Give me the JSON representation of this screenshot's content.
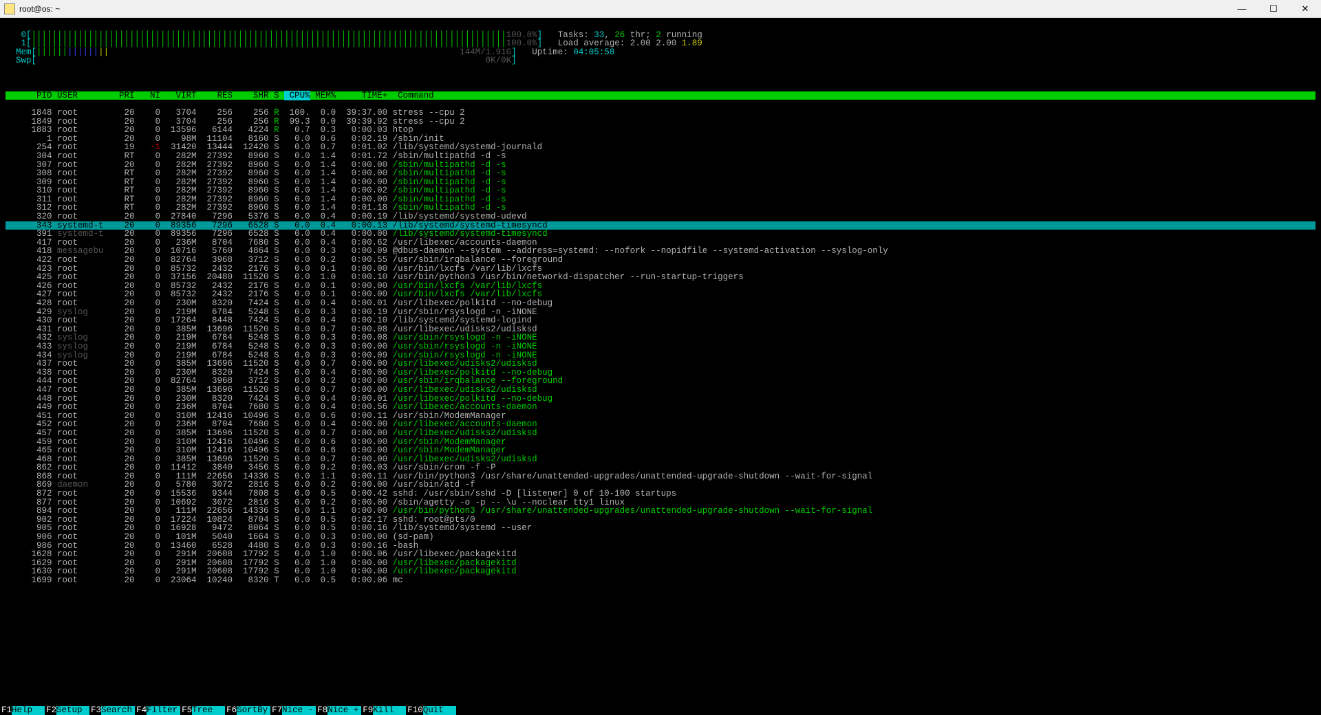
{
  "window": {
    "title": "root@os: ~"
  },
  "cpus": [
    {
      "id": "0",
      "percent": "100.0%"
    },
    {
      "id": "1",
      "percent": "100.0%"
    }
  ],
  "mem": {
    "label": "Mem",
    "used": "144M",
    "total": "1.91G"
  },
  "swp": {
    "label": "Swp",
    "used": "0K",
    "total": "0K"
  },
  "summary": {
    "tasks": "Tasks: 33, 26 thr; 2 running",
    "load": "Load average: 2.00 2.00 1.89",
    "uptime": "Uptime: 04:05:58"
  },
  "cols": [
    "PID",
    "USER",
    "PRI",
    "NI",
    "VIRT",
    "RES",
    "SHR",
    "S",
    "CPU%",
    "MEM%",
    "TIME+",
    "Command"
  ],
  "selected_pid": 343,
  "processes": [
    {
      "pid": 1848,
      "user": "root",
      "pri": "20",
      "ni": "0",
      "virt": "3704",
      "res": "256",
      "shr": "256",
      "s": "R",
      "cpu": "100.",
      "mem": "0.0",
      "time": "39:37.00",
      "cmd": "stress --cpu 2",
      "style": "plain"
    },
    {
      "pid": 1849,
      "user": "root",
      "pri": "20",
      "ni": "0",
      "virt": "3704",
      "res": "256",
      "shr": "256",
      "s": "R",
      "cpu": "99.3",
      "mem": "0.0",
      "time": "39:39.92",
      "cmd": "stress --cpu 2",
      "style": "plain"
    },
    {
      "pid": 1883,
      "user": "root",
      "pri": "20",
      "ni": "0",
      "virt": "13596",
      "res": "6144",
      "shr": "4224",
      "s": "R",
      "cpu": "0.7",
      "mem": "0.3",
      "time": "0:00.03",
      "cmd": "htop",
      "style": "plain"
    },
    {
      "pid": 1,
      "user": "root",
      "pri": "20",
      "ni": "0",
      "virt": "98M",
      "res": "11104",
      "shr": "8160",
      "s": "S",
      "cpu": "0.0",
      "mem": "0.6",
      "time": "0:02.19",
      "cmd": "/sbin/init",
      "style": "plain"
    },
    {
      "pid": 254,
      "user": "root",
      "pri": "19",
      "ni": "-1",
      "virt": "31420",
      "res": "13444",
      "shr": "12420",
      "s": "S",
      "cpu": "0.0",
      "mem": "0.7",
      "time": "0:01.02",
      "cmd": "/lib/systemd/systemd-journald",
      "style": "plain",
      "ni_red": true
    },
    {
      "pid": 304,
      "user": "root",
      "pri": "RT",
      "ni": "0",
      "virt": "282M",
      "res": "27392",
      "shr": "8960",
      "s": "S",
      "cpu": "0.0",
      "mem": "1.4",
      "time": "0:01.72",
      "cmd": "/sbin/multipathd -d -s",
      "style": "plain"
    },
    {
      "pid": 307,
      "user": "root",
      "pri": "20",
      "ni": "0",
      "virt": "282M",
      "res": "27392",
      "shr": "8960",
      "s": "S",
      "cpu": "0.0",
      "mem": "1.4",
      "time": "0:00.00",
      "cmd": "/sbin/multipathd -d -s",
      "style": "green"
    },
    {
      "pid": 308,
      "user": "root",
      "pri": "RT",
      "ni": "0",
      "virt": "282M",
      "res": "27392",
      "shr": "8960",
      "s": "S",
      "cpu": "0.0",
      "mem": "1.4",
      "time": "0:00.00",
      "cmd": "/sbin/multipathd -d -s",
      "style": "green"
    },
    {
      "pid": 309,
      "user": "root",
      "pri": "RT",
      "ni": "0",
      "virt": "282M",
      "res": "27392",
      "shr": "8960",
      "s": "S",
      "cpu": "0.0",
      "mem": "1.4",
      "time": "0:00.00",
      "cmd": "/sbin/multipathd -d -s",
      "style": "green"
    },
    {
      "pid": 310,
      "user": "root",
      "pri": "RT",
      "ni": "0",
      "virt": "282M",
      "res": "27392",
      "shr": "8960",
      "s": "S",
      "cpu": "0.0",
      "mem": "1.4",
      "time": "0:00.02",
      "cmd": "/sbin/multipathd -d -s",
      "style": "green"
    },
    {
      "pid": 311,
      "user": "root",
      "pri": "RT",
      "ni": "0",
      "virt": "282M",
      "res": "27392",
      "shr": "8960",
      "s": "S",
      "cpu": "0.0",
      "mem": "1.4",
      "time": "0:00.00",
      "cmd": "/sbin/multipathd -d -s",
      "style": "green"
    },
    {
      "pid": 312,
      "user": "root",
      "pri": "RT",
      "ni": "0",
      "virt": "282M",
      "res": "27392",
      "shr": "8960",
      "s": "S",
      "cpu": "0.0",
      "mem": "1.4",
      "time": "0:01.18",
      "cmd": "/sbin/multipathd -d -s",
      "style": "green"
    },
    {
      "pid": 320,
      "user": "root",
      "pri": "20",
      "ni": "0",
      "virt": "27840",
      "res": "7296",
      "shr": "5376",
      "s": "S",
      "cpu": "0.0",
      "mem": "0.4",
      "time": "0:00.19",
      "cmd": "/lib/systemd/systemd-udevd",
      "style": "plain"
    },
    {
      "pid": 343,
      "user": "systemd-t",
      "pri": "20",
      "ni": "0",
      "virt": "89356",
      "res": "7296",
      "shr": "6528",
      "s": "S",
      "cpu": "0.0",
      "mem": "0.4",
      "time": "0:00.13",
      "cmd": "/lib/systemd/systemd-timesyncd",
      "style": "selected"
    },
    {
      "pid": 391,
      "user": "systemd-t",
      "pri": "20",
      "ni": "0",
      "virt": "89356",
      "res": "7296",
      "shr": "6528",
      "s": "S",
      "cpu": "0.0",
      "mem": "0.4",
      "time": "0:00.00",
      "cmd": "/lib/systemd/systemd-timesyncd",
      "style": "green",
      "user_grey": true
    },
    {
      "pid": 417,
      "user": "root",
      "pri": "20",
      "ni": "0",
      "virt": "236M",
      "res": "8704",
      "shr": "7680",
      "s": "S",
      "cpu": "0.0",
      "mem": "0.4",
      "time": "0:00.62",
      "cmd": "/usr/libexec/accounts-daemon",
      "style": "plain"
    },
    {
      "pid": 418,
      "user": "messagebu",
      "pri": "20",
      "ni": "0",
      "virt": "10716",
      "res": "5760",
      "shr": "4864",
      "s": "S",
      "cpu": "0.0",
      "mem": "0.3",
      "time": "0:00.09",
      "cmd": "@dbus-daemon --system --address=systemd: --nofork --nopidfile --systemd-activation --syslog-only",
      "style": "plain",
      "user_grey": true
    },
    {
      "pid": 422,
      "user": "root",
      "pri": "20",
      "ni": "0",
      "virt": "82764",
      "res": "3968",
      "shr": "3712",
      "s": "S",
      "cpu": "0.0",
      "mem": "0.2",
      "time": "0:00.55",
      "cmd": "/usr/sbin/irqbalance --foreground",
      "style": "plain"
    },
    {
      "pid": 423,
      "user": "root",
      "pri": "20",
      "ni": "0",
      "virt": "85732",
      "res": "2432",
      "shr": "2176",
      "s": "S",
      "cpu": "0.0",
      "mem": "0.1",
      "time": "0:00.00",
      "cmd": "/usr/bin/lxcfs /var/lib/lxcfs",
      "style": "plain"
    },
    {
      "pid": 425,
      "user": "root",
      "pri": "20",
      "ni": "0",
      "virt": "37156",
      "res": "20480",
      "shr": "11520",
      "s": "S",
      "cpu": "0.0",
      "mem": "1.0",
      "time": "0:00.10",
      "cmd": "/usr/bin/python3 /usr/bin/networkd-dispatcher --run-startup-triggers",
      "style": "plain"
    },
    {
      "pid": 426,
      "user": "root",
      "pri": "20",
      "ni": "0",
      "virt": "85732",
      "res": "2432",
      "shr": "2176",
      "s": "S",
      "cpu": "0.0",
      "mem": "0.1",
      "time": "0:00.00",
      "cmd": "/usr/bin/lxcfs /var/lib/lxcfs",
      "style": "green"
    },
    {
      "pid": 427,
      "user": "root",
      "pri": "20",
      "ni": "0",
      "virt": "85732",
      "res": "2432",
      "shr": "2176",
      "s": "S",
      "cpu": "0.0",
      "mem": "0.1",
      "time": "0:00.00",
      "cmd": "/usr/bin/lxcfs /var/lib/lxcfs",
      "style": "green"
    },
    {
      "pid": 428,
      "user": "root",
      "pri": "20",
      "ni": "0",
      "virt": "230M",
      "res": "8320",
      "shr": "7424",
      "s": "S",
      "cpu": "0.0",
      "mem": "0.4",
      "time": "0:00.01",
      "cmd": "/usr/libexec/polkitd --no-debug",
      "style": "plain"
    },
    {
      "pid": 429,
      "user": "syslog",
      "pri": "20",
      "ni": "0",
      "virt": "219M",
      "res": "6784",
      "shr": "5248",
      "s": "S",
      "cpu": "0.0",
      "mem": "0.3",
      "time": "0:00.19",
      "cmd": "/usr/sbin/rsyslogd -n -iNONE",
      "style": "plain",
      "user_grey": true
    },
    {
      "pid": 430,
      "user": "root",
      "pri": "20",
      "ni": "0",
      "virt": "17264",
      "res": "8448",
      "shr": "7424",
      "s": "S",
      "cpu": "0.0",
      "mem": "0.4",
      "time": "0:00.10",
      "cmd": "/lib/systemd/systemd-logind",
      "style": "plain"
    },
    {
      "pid": 431,
      "user": "root",
      "pri": "20",
      "ni": "0",
      "virt": "385M",
      "res": "13696",
      "shr": "11520",
      "s": "S",
      "cpu": "0.0",
      "mem": "0.7",
      "time": "0:00.08",
      "cmd": "/usr/libexec/udisks2/udisksd",
      "style": "plain"
    },
    {
      "pid": 432,
      "user": "syslog",
      "pri": "20",
      "ni": "0",
      "virt": "219M",
      "res": "6784",
      "shr": "5248",
      "s": "S",
      "cpu": "0.0",
      "mem": "0.3",
      "time": "0:00.08",
      "cmd": "/usr/sbin/rsyslogd -n -iNONE",
      "style": "green",
      "user_grey": true
    },
    {
      "pid": 433,
      "user": "syslog",
      "pri": "20",
      "ni": "0",
      "virt": "219M",
      "res": "6784",
      "shr": "5248",
      "s": "S",
      "cpu": "0.0",
      "mem": "0.3",
      "time": "0:00.00",
      "cmd": "/usr/sbin/rsyslogd -n -iNONE",
      "style": "green",
      "user_grey": true
    },
    {
      "pid": 434,
      "user": "syslog",
      "pri": "20",
      "ni": "0",
      "virt": "219M",
      "res": "6784",
      "shr": "5248",
      "s": "S",
      "cpu": "0.0",
      "mem": "0.3",
      "time": "0:00.09",
      "cmd": "/usr/sbin/rsyslogd -n -iNONE",
      "style": "green",
      "user_grey": true
    },
    {
      "pid": 437,
      "user": "root",
      "pri": "20",
      "ni": "0",
      "virt": "385M",
      "res": "13696",
      "shr": "11520",
      "s": "S",
      "cpu": "0.0",
      "mem": "0.7",
      "time": "0:00.00",
      "cmd": "/usr/libexec/udisks2/udisksd",
      "style": "green"
    },
    {
      "pid": 438,
      "user": "root",
      "pri": "20",
      "ni": "0",
      "virt": "230M",
      "res": "8320",
      "shr": "7424",
      "s": "S",
      "cpu": "0.0",
      "mem": "0.4",
      "time": "0:00.00",
      "cmd": "/usr/libexec/polkitd --no-debug",
      "style": "green"
    },
    {
      "pid": 444,
      "user": "root",
      "pri": "20",
      "ni": "0",
      "virt": "82764",
      "res": "3968",
      "shr": "3712",
      "s": "S",
      "cpu": "0.0",
      "mem": "0.2",
      "time": "0:00.00",
      "cmd": "/usr/sbin/irqbalance --foreground",
      "style": "green"
    },
    {
      "pid": 447,
      "user": "root",
      "pri": "20",
      "ni": "0",
      "virt": "385M",
      "res": "13696",
      "shr": "11520",
      "s": "S",
      "cpu": "0.0",
      "mem": "0.7",
      "time": "0:00.00",
      "cmd": "/usr/libexec/udisks2/udisksd",
      "style": "green"
    },
    {
      "pid": 448,
      "user": "root",
      "pri": "20",
      "ni": "0",
      "virt": "230M",
      "res": "8320",
      "shr": "7424",
      "s": "S",
      "cpu": "0.0",
      "mem": "0.4",
      "time": "0:00.01",
      "cmd": "/usr/libexec/polkitd --no-debug",
      "style": "green"
    },
    {
      "pid": 449,
      "user": "root",
      "pri": "20",
      "ni": "0",
      "virt": "236M",
      "res": "8704",
      "shr": "7680",
      "s": "S",
      "cpu": "0.0",
      "mem": "0.4",
      "time": "0:00.56",
      "cmd": "/usr/libexec/accounts-daemon",
      "style": "green"
    },
    {
      "pid": 451,
      "user": "root",
      "pri": "20",
      "ni": "0",
      "virt": "310M",
      "res": "12416",
      "shr": "10496",
      "s": "S",
      "cpu": "0.0",
      "mem": "0.6",
      "time": "0:00.11",
      "cmd": "/usr/sbin/ModemManager",
      "style": "plain"
    },
    {
      "pid": 452,
      "user": "root",
      "pri": "20",
      "ni": "0",
      "virt": "236M",
      "res": "8704",
      "shr": "7680",
      "s": "S",
      "cpu": "0.0",
      "mem": "0.4",
      "time": "0:00.00",
      "cmd": "/usr/libexec/accounts-daemon",
      "style": "green"
    },
    {
      "pid": 457,
      "user": "root",
      "pri": "20",
      "ni": "0",
      "virt": "385M",
      "res": "13696",
      "shr": "11520",
      "s": "S",
      "cpu": "0.0",
      "mem": "0.7",
      "time": "0:00.00",
      "cmd": "/usr/libexec/udisks2/udisksd",
      "style": "green"
    },
    {
      "pid": 459,
      "user": "root",
      "pri": "20",
      "ni": "0",
      "virt": "310M",
      "res": "12416",
      "shr": "10496",
      "s": "S",
      "cpu": "0.0",
      "mem": "0.6",
      "time": "0:00.00",
      "cmd": "/usr/sbin/ModemManager",
      "style": "green"
    },
    {
      "pid": 465,
      "user": "root",
      "pri": "20",
      "ni": "0",
      "virt": "310M",
      "res": "12416",
      "shr": "10496",
      "s": "S",
      "cpu": "0.0",
      "mem": "0.6",
      "time": "0:00.00",
      "cmd": "/usr/sbin/ModemManager",
      "style": "green"
    },
    {
      "pid": 468,
      "user": "root",
      "pri": "20",
      "ni": "0",
      "virt": "385M",
      "res": "13696",
      "shr": "11520",
      "s": "S",
      "cpu": "0.0",
      "mem": "0.7",
      "time": "0:00.00",
      "cmd": "/usr/libexec/udisks2/udisksd",
      "style": "green"
    },
    {
      "pid": 862,
      "user": "root",
      "pri": "20",
      "ni": "0",
      "virt": "11412",
      "res": "3840",
      "shr": "3456",
      "s": "S",
      "cpu": "0.0",
      "mem": "0.2",
      "time": "0:00.03",
      "cmd": "/usr/sbin/cron -f -P",
      "style": "plain"
    },
    {
      "pid": 868,
      "user": "root",
      "pri": "20",
      "ni": "0",
      "virt": "111M",
      "res": "22656",
      "shr": "14336",
      "s": "S",
      "cpu": "0.0",
      "mem": "1.1",
      "time": "0:00.11",
      "cmd": "/usr/bin/python3 /usr/share/unattended-upgrades/unattended-upgrade-shutdown --wait-for-signal",
      "style": "plain"
    },
    {
      "pid": 869,
      "user": "daemon",
      "pri": "20",
      "ni": "0",
      "virt": "5780",
      "res": "3072",
      "shr": "2816",
      "s": "S",
      "cpu": "0.0",
      "mem": "0.2",
      "time": "0:00.00",
      "cmd": "/usr/sbin/atd -f",
      "style": "plain",
      "user_grey": true
    },
    {
      "pid": 872,
      "user": "root",
      "pri": "20",
      "ni": "0",
      "virt": "15536",
      "res": "9344",
      "shr": "7808",
      "s": "S",
      "cpu": "0.0",
      "mem": "0.5",
      "time": "0:00.42",
      "cmd": "sshd: /usr/sbin/sshd -D [listener] 0 of 10-100 startups",
      "style": "plain"
    },
    {
      "pid": 877,
      "user": "root",
      "pri": "20",
      "ni": "0",
      "virt": "10692",
      "res": "3072",
      "shr": "2816",
      "s": "S",
      "cpu": "0.0",
      "mem": "0.2",
      "time": "0:00.00",
      "cmd": "/sbin/agetty -o -p -- \\u --noclear tty1 linux",
      "style": "plain"
    },
    {
      "pid": 894,
      "user": "root",
      "pri": "20",
      "ni": "0",
      "virt": "111M",
      "res": "22656",
      "shr": "14336",
      "s": "S",
      "cpu": "0.0",
      "mem": "1.1",
      "time": "0:00.00",
      "cmd": "/usr/bin/python3 /usr/share/unattended-upgrades/unattended-upgrade-shutdown --wait-for-signal",
      "style": "green"
    },
    {
      "pid": 902,
      "user": "root",
      "pri": "20",
      "ni": "0",
      "virt": "17224",
      "res": "10824",
      "shr": "8704",
      "s": "S",
      "cpu": "0.0",
      "mem": "0.5",
      "time": "0:02.17",
      "cmd": "sshd: root@pts/0",
      "style": "plain"
    },
    {
      "pid": 905,
      "user": "root",
      "pri": "20",
      "ni": "0",
      "virt": "16928",
      "res": "9472",
      "shr": "8064",
      "s": "S",
      "cpu": "0.0",
      "mem": "0.5",
      "time": "0:00.16",
      "cmd": "/lib/systemd/systemd --user",
      "style": "plain"
    },
    {
      "pid": 906,
      "user": "root",
      "pri": "20",
      "ni": "0",
      "virt": "101M",
      "res": "5040",
      "shr": "1664",
      "s": "S",
      "cpu": "0.0",
      "mem": "0.3",
      "time": "0:00.00",
      "cmd": "(sd-pam)",
      "style": "plain"
    },
    {
      "pid": 986,
      "user": "root",
      "pri": "20",
      "ni": "0",
      "virt": "13460",
      "res": "6528",
      "shr": "4480",
      "s": "S",
      "cpu": "0.0",
      "mem": "0.3",
      "time": "0:00.16",
      "cmd": "-bash",
      "style": "plain"
    },
    {
      "pid": 1628,
      "user": "root",
      "pri": "20",
      "ni": "0",
      "virt": "291M",
      "res": "20608",
      "shr": "17792",
      "s": "S",
      "cpu": "0.0",
      "mem": "1.0",
      "time": "0:00.06",
      "cmd": "/usr/libexec/packagekitd",
      "style": "plain"
    },
    {
      "pid": 1629,
      "user": "root",
      "pri": "20",
      "ni": "0",
      "virt": "291M",
      "res": "20608",
      "shr": "17792",
      "s": "S",
      "cpu": "0.0",
      "mem": "1.0",
      "time": "0:00.00",
      "cmd": "/usr/libexec/packagekitd",
      "style": "green"
    },
    {
      "pid": 1630,
      "user": "root",
      "pri": "20",
      "ni": "0",
      "virt": "291M",
      "res": "20608",
      "shr": "17792",
      "s": "S",
      "cpu": "0.0",
      "mem": "1.0",
      "time": "0:00.00",
      "cmd": "/usr/libexec/packagekitd",
      "style": "green"
    },
    {
      "pid": 1699,
      "user": "root",
      "pri": "20",
      "ni": "0",
      "virt": "23064",
      "res": "10240",
      "shr": "8320",
      "s": "T",
      "cpu": "0.0",
      "mem": "0.5",
      "time": "0:00.06",
      "cmd": "mc",
      "style": "plain"
    }
  ],
  "fkeys": [
    {
      "k": "F1",
      "l": "Help"
    },
    {
      "k": "F2",
      "l": "Setup"
    },
    {
      "k": "F3",
      "l": "Search"
    },
    {
      "k": "F4",
      "l": "Filter"
    },
    {
      "k": "F5",
      "l": "Tree"
    },
    {
      "k": "F6",
      "l": "SortBy"
    },
    {
      "k": "F7",
      "l": "Nice -"
    },
    {
      "k": "F8",
      "l": "Nice +"
    },
    {
      "k": "F9",
      "l": "Kill"
    },
    {
      "k": "F10",
      "l": "Quit"
    }
  ]
}
